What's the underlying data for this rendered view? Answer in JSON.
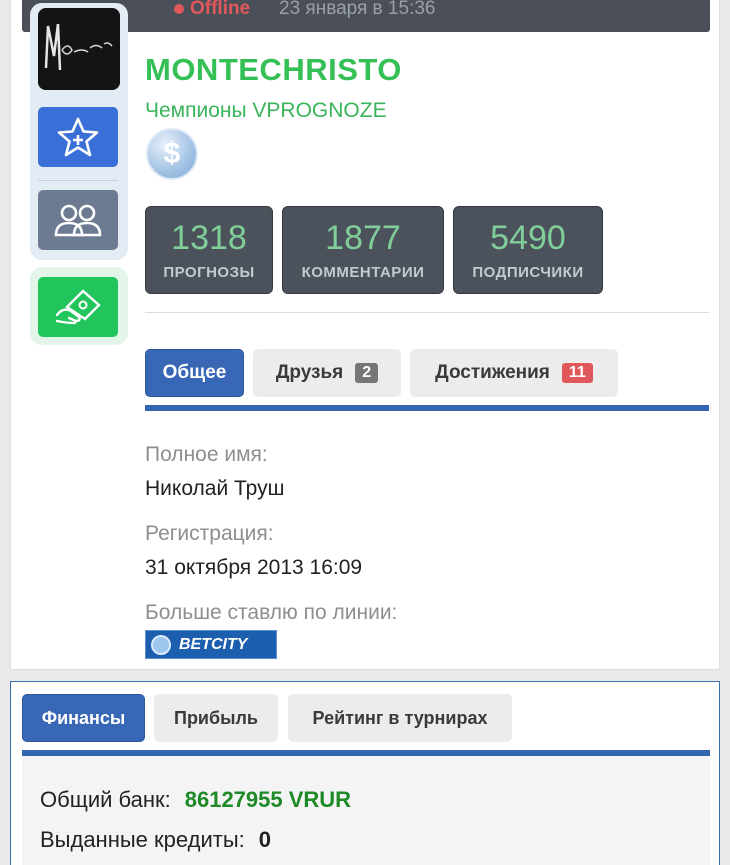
{
  "header": {
    "status": "Offline",
    "last_seen": "23 января в 15:36"
  },
  "sidebar": {
    "avatar_alt": "Montecristo",
    "buttons": [
      {
        "icon": "star-plus-icon"
      },
      {
        "icon": "users-icon"
      },
      {
        "icon": "donate-icon"
      }
    ]
  },
  "profile": {
    "username": "MONTECHRISTO",
    "group": "Чемпионы VPROGNOZE",
    "coin_symbol": "$"
  },
  "stats": [
    {
      "value": "1318",
      "label": "ПРОГНОЗЫ"
    },
    {
      "value": "1877",
      "label": "КОММЕНТАРИИ"
    },
    {
      "value": "5490",
      "label": "ПОДПИСЧИКИ"
    }
  ],
  "tabs": [
    {
      "label": "Общее",
      "active": true
    },
    {
      "label": "Друзья",
      "badge": "2"
    },
    {
      "label": "Достижения",
      "badge": "11"
    }
  ],
  "info": {
    "full_name_label": "Полное имя:",
    "full_name": "Николай Труш",
    "registration_label": "Регистрация:",
    "registration": "31 октября 2013 16:09",
    "line_label": "Больше ставлю по линии:",
    "bookmaker": "BETCITY"
  },
  "finance": {
    "tabs": [
      {
        "label": "Финансы",
        "active": true
      },
      {
        "label": "Прибыль"
      },
      {
        "label": "Рейтинг в турнирах"
      }
    ],
    "bank_label": "Общий банк:",
    "bank_value": "86127955 VRUR",
    "credits_label": "Выданные кредиты:",
    "credits_value": "0"
  },
  "colors": {
    "accent_blue": "#3867b5",
    "username_green": "#35c056",
    "offline_red": "#e0585b",
    "bank_green": "#1d8a27"
  }
}
